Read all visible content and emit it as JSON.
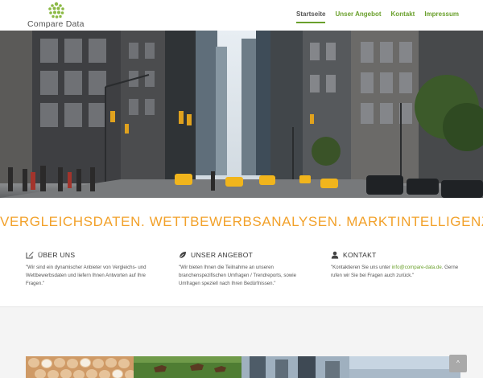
{
  "brand": {
    "name": "Compare Data",
    "logo_color": "#8bb944"
  },
  "nav": {
    "items": [
      {
        "label": "Startseite",
        "active": true
      },
      {
        "label": "Unser Angebot",
        "active": false
      },
      {
        "label": "Kontakt",
        "active": false
      },
      {
        "label": "Impressum",
        "active": false
      }
    ],
    "accent": "#6aa02c"
  },
  "hero": {
    "image": "city-street-photo"
  },
  "tagline": "VERGLEICHSDATEN. WETTBEWERBSANALYSEN. MARKTINTELLIGENZ.",
  "features": [
    {
      "icon": "edit-icon",
      "title": "ÜBER UNS",
      "text": "\"Wir sind ein dynamischer Anbieter von Vergleichs- und Wettbewerbsdaten und liefern Ihnen Antworten auf Ihre Fragen.\""
    },
    {
      "icon": "leaf-icon",
      "title": "UNSER ANGEBOT",
      "text": "\"Wir bieten Ihnen die Teilnahme an unseren branchenspezifischen Umfragen / Trendreports, sowie Umfragen speziell nach Ihren Bedürfnissen.\""
    },
    {
      "icon": "user-icon",
      "title": "KONTAKT",
      "text_before": "\"Kontaktieren Sie uns unter ",
      "email": "info@compare-data.de",
      "text_after": ". Gerne rufen wir Sie bei Fragen auch zurück.\""
    }
  ],
  "gallery": [
    "eggs-photo",
    "horses-photo",
    "city-photo",
    "sky-photo"
  ],
  "back_to_top": {
    "icon": "chevron-up-icon"
  },
  "colors": {
    "tagline": "#f2a12a",
    "accent": "#6aa02c"
  }
}
